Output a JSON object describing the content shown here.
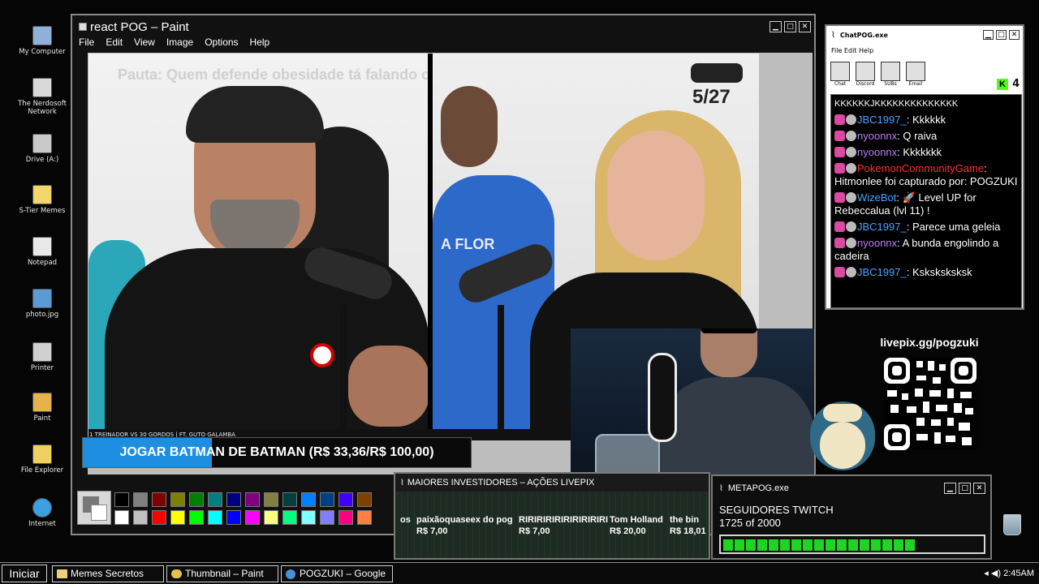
{
  "desktop_icons": [
    {
      "label": "My Computer",
      "icon": "computer-icon"
    },
    {
      "label": "The Nerdosoft Network",
      "icon": "network-icon"
    },
    {
      "label": "Drive (A:)",
      "icon": "floppy-drive-icon"
    },
    {
      "label": "S-Tier Memes",
      "icon": "folder-icon"
    },
    {
      "label": "Notepad",
      "icon": "notepad-icon"
    },
    {
      "label": "photo.jpg",
      "icon": "image-file-icon"
    },
    {
      "label": "Printer",
      "icon": "printer-icon"
    },
    {
      "label": "Paint",
      "icon": "paint-icon"
    },
    {
      "label": "File Explorer",
      "icon": "file-explorer-icon"
    },
    {
      "label": "Internet",
      "icon": "internet-globe-icon"
    }
  ],
  "paint": {
    "title": "react POG – Paint",
    "menu": [
      "File",
      "Edit",
      "View",
      "Image",
      "Options",
      "Help"
    ],
    "video": {
      "pauta": "Pauta: Quem defende obesidade tá falando o SUS",
      "counter": "5/27",
      "bottom_strip": "1 TREINADOR VS 30 GORDOS | FT. GUTO GALAMBA",
      "shirt_text": "A FLOR"
    },
    "redeem_bar": {
      "label": "JOGAR BATMAN DE BATMAN (R$ 33,36/R$ 100,00)",
      "progress": 0.3336
    },
    "palette_top": [
      "#000000",
      "#808080",
      "#800000",
      "#808000",
      "#008000",
      "#008080",
      "#000080",
      "#800080",
      "#808040",
      "#004040",
      "#0080ff",
      "#004080",
      "#4000ff",
      "#804000"
    ],
    "palette_bottom": [
      "#ffffff",
      "#c0c0c0",
      "#ff0000",
      "#ffff00",
      "#00ff00",
      "#00ffff",
      "#0000ff",
      "#ff00ff",
      "#ffff80",
      "#00ff80",
      "#80ffff",
      "#8080ff",
      "#ff0080",
      "#ff8040"
    ]
  },
  "chat": {
    "title": "ChatPOG.exe",
    "menu": "File Edit Help",
    "toolbar": [
      "Chat",
      "Discord",
      "SUBs",
      "Email"
    ],
    "viewer_count": "4",
    "messages": [
      {
        "user": "",
        "text": "KKKKKKJKKKKKKKKKKKKKK",
        "color": "#ffffff"
      },
      {
        "user": "JBC1997_",
        "text": ": Kkkkkk",
        "color": "#4aa3ff"
      },
      {
        "user": "nyoonnx",
        "text": ": Q raiva",
        "color": "#c07bff"
      },
      {
        "user": "nyoonnx",
        "text": ": Kkkkkkk",
        "color": "#c07bff"
      },
      {
        "user": "PokemonCommunityGame",
        "text": ": Hitmonlee foi capturado por: POGZUKI",
        "color": "#ff3030"
      },
      {
        "user": "WizeBot",
        "text": ": 🚀 Level UP for Rebeccalua (lvl 11) !",
        "color": "#4aa3ff"
      },
      {
        "user": "JBC1997_",
        "text": ": Parece uma geleia",
        "color": "#4aa3ff"
      },
      {
        "user": "nyoonnx",
        "text": ": A bunda engolindo a cadeira",
        "color": "#c07bff"
      },
      {
        "user": "JBC1997_",
        "text": ": Ksksksksksk",
        "color": "#4aa3ff"
      }
    ]
  },
  "livepix": {
    "url": "livepix.gg/pogzuki"
  },
  "investors": {
    "title": "MAIORES INVESTIDORES – AÇÕES LIVEPIX",
    "items": [
      {
        "name": "os",
        "amount": ""
      },
      {
        "name": "paixãoquaseex do pog",
        "amount": "R$ 7,00"
      },
      {
        "name": "RIRIRIRIRIRIRIRIRIRI",
        "amount": "R$ 7,00"
      },
      {
        "name": "Tom Holland",
        "amount": "R$ 20,00"
      },
      {
        "name": "the bin",
        "amount": "R$ 18,01"
      }
    ]
  },
  "metapog": {
    "title": "METAPOG.exe",
    "label": "SEGUIDORES TWITCH",
    "value": "1725 of 2000",
    "progress": 0.8625
  },
  "taskbar": {
    "start": "Iniciar",
    "tasks": [
      "Memes Secretos",
      "Thumbnail – Paint",
      "POGZUKI – Google"
    ],
    "clock": "2:45AM"
  }
}
